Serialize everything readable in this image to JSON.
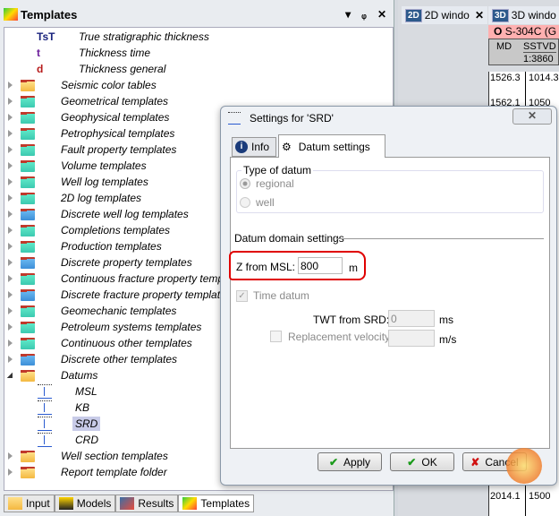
{
  "left_panel": {
    "title": "Templates",
    "tree": [
      {
        "label": "True stratigraphic thickness",
        "icon": "tst-icon",
        "glyph": "TsT",
        "level": 2
      },
      {
        "label": "Thickness time",
        "icon": "thickness-time-icon",
        "glyph": "t",
        "level": 2
      },
      {
        "label": "Thickness general",
        "icon": "thickness-general-icon",
        "glyph": "d",
        "level": 2
      },
      {
        "label": "Seismic color tables",
        "icon": "seismic-folder-icon",
        "level": 1
      },
      {
        "label": "Geometrical templates",
        "icon": "folder-cyan-icon",
        "level": 1
      },
      {
        "label": "Geophysical templates",
        "icon": "folder-cyan-icon",
        "level": 1
      },
      {
        "label": "Petrophysical templates",
        "icon": "folder-cyan-icon",
        "level": 1
      },
      {
        "label": "Fault property templates",
        "icon": "folder-cyan-icon",
        "level": 1
      },
      {
        "label": "Volume templates",
        "icon": "folder-cyan-icon",
        "level": 1
      },
      {
        "label": "Well log templates",
        "icon": "folder-cyan-icon",
        "level": 1
      },
      {
        "label": "2D log templates",
        "icon": "folder-cyan-icon",
        "level": 1
      },
      {
        "label": "Discrete well log templates",
        "icon": "folder-blue-icon",
        "level": 1
      },
      {
        "label": "Completions templates",
        "icon": "folder-cyan-icon",
        "level": 1
      },
      {
        "label": "Production templates",
        "icon": "folder-cyan-icon",
        "level": 1
      },
      {
        "label": "Discrete property templates",
        "icon": "folder-blue-icon",
        "level": 1
      },
      {
        "label": "Continuous fracture property templates",
        "icon": "folder-cyan-icon",
        "level": 1
      },
      {
        "label": "Discrete fracture property templates",
        "icon": "folder-blue-icon",
        "level": 1
      },
      {
        "label": "Geomechanic templates",
        "icon": "folder-cyan-icon",
        "level": 1
      },
      {
        "label": "Petroleum systems templates",
        "icon": "folder-cyan-icon",
        "level": 1
      },
      {
        "label": "Continuous other templates",
        "icon": "folder-cyan-icon",
        "level": 1
      },
      {
        "label": "Discrete other templates",
        "icon": "folder-blue-icon",
        "level": 1
      },
      {
        "label": "Datums",
        "icon": "folder-yellow-icon",
        "level": 1,
        "expanded": true
      },
      {
        "label": "MSL",
        "icon": "datum-icon",
        "level": 2
      },
      {
        "label": "KB",
        "icon": "datum-icon",
        "level": 2
      },
      {
        "label": "SRD",
        "icon": "datum-icon",
        "level": 2,
        "selected": true
      },
      {
        "label": "CRD",
        "icon": "datum-icon",
        "level": 2
      },
      {
        "label": "Well section templates",
        "icon": "folder-yellow-icon",
        "level": 1
      },
      {
        "label": "Report template folder",
        "icon": "folder-yellow-icon",
        "level": 1
      }
    ],
    "bottom_tabs": [
      "Input",
      "Models",
      "Results",
      "Templates"
    ],
    "active_tab": "Templates"
  },
  "right_panel": {
    "tabs": [
      "2D windo",
      "3D windo"
    ],
    "tab_badges": [
      "2D",
      "3D"
    ],
    "well_name": "S-304C (G",
    "col_md": "MD",
    "col_sstvd": "SSTVD",
    "scale": "1:3860",
    "depths": [
      [
        "1526.3",
        "1014.3"
      ],
      [
        "1562.1",
        "1050"
      ],
      [
        "2014.1",
        "1500"
      ]
    ]
  },
  "dialog": {
    "title": "Settings for 'SRD'",
    "tabs": [
      "Info",
      "Datum settings"
    ],
    "active_tab": "Datum settings",
    "type_group": "Type of datum",
    "radio_regional": "regional",
    "radio_well": "well",
    "selected_type": "regional",
    "domain_section": "Datum domain settings",
    "z_label": "Z from MSL:",
    "z_value": "800",
    "z_unit": "m",
    "time_datum_label": "Time datum",
    "time_datum_checked": true,
    "twt_label": "TWT from SRD:",
    "twt_value": "0",
    "twt_unit": "ms",
    "repl_label": "Replacement velocity:",
    "repl_value": "",
    "repl_unit": "m/s",
    "repl_checked": false,
    "apply": "Apply",
    "ok": "OK",
    "cancel": "Cancel",
    "highlight_color": "#e00000"
  }
}
